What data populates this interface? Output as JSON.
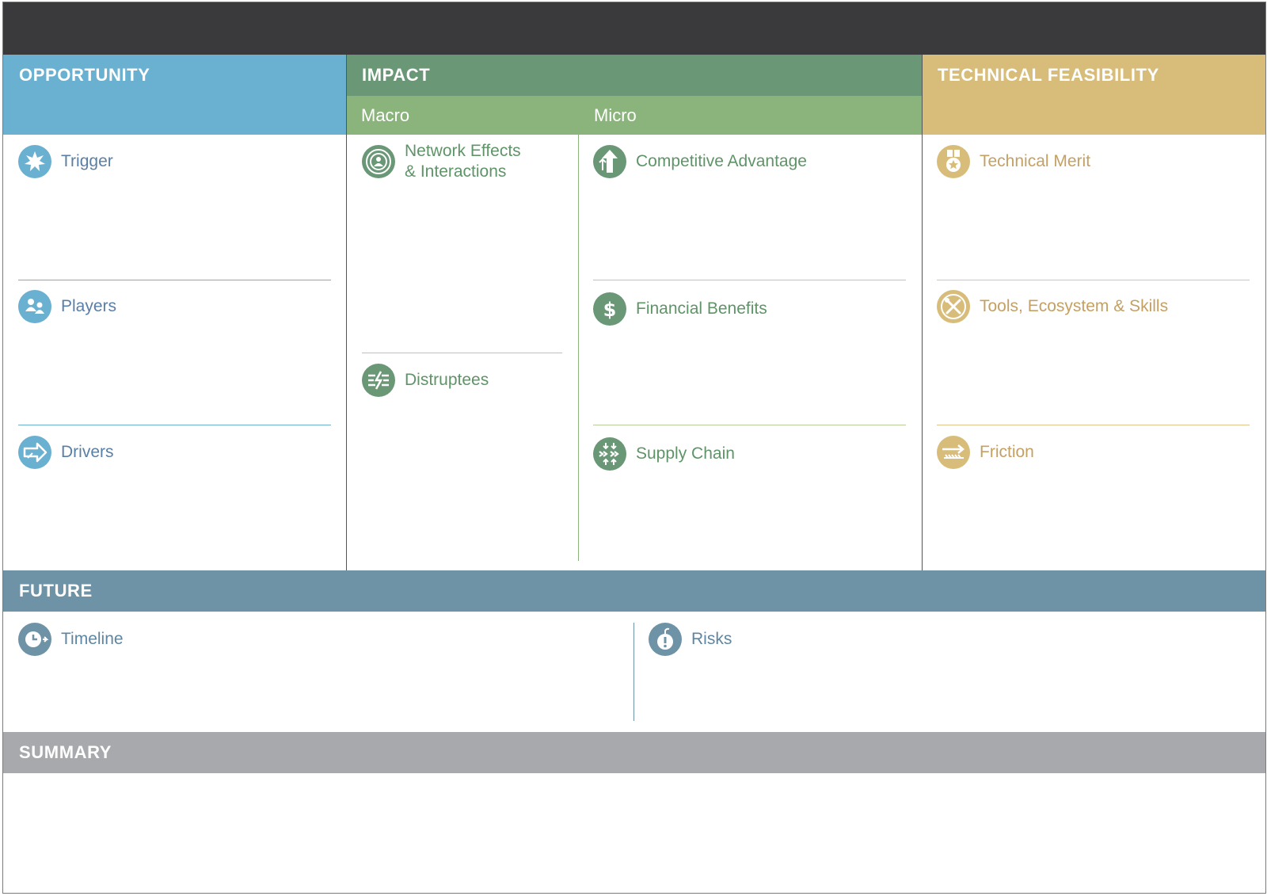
{
  "title_bar": "",
  "colors": {
    "opportunity": "#6ab0d0",
    "impact": "#6a9776",
    "impact_sub": "#8bb47d",
    "technical_feasibility": "#d8bc79",
    "future": "#6f93a6",
    "summary": "#a7a9ac",
    "top_bar": "#3a3a3c"
  },
  "opportunity": {
    "header": "OPPORTUNITY",
    "items": [
      {
        "label": "Trigger",
        "icon": "burst-icon"
      },
      {
        "label": "Players",
        "icon": "people-icon"
      },
      {
        "label": "Drivers",
        "icon": "arrow-icon"
      }
    ]
  },
  "impact": {
    "header": "IMPACT",
    "macro": {
      "header": "Macro",
      "items": [
        {
          "label_line1": "Network Effects",
          "label_line2": "& Interactions",
          "icon": "network-icon"
        },
        {
          "label": "Distruptees",
          "icon": "disruption-icon"
        }
      ]
    },
    "micro": {
      "header": "Micro",
      "items": [
        {
          "label": "Competitive Advantage",
          "icon": "up-arrow-icon"
        },
        {
          "label": "Financial Benefits",
          "icon": "dollar-icon"
        },
        {
          "label": "Supply Chain",
          "icon": "supply-chain-icon"
        }
      ]
    }
  },
  "technical_feasibility": {
    "header": "TECHNICAL FEASIBILITY",
    "items": [
      {
        "label": "Technical Merit",
        "icon": "medal-icon"
      },
      {
        "label": "Tools, Ecosystem & Skills",
        "icon": "tools-icon"
      },
      {
        "label": "Friction",
        "icon": "friction-icon"
      }
    ]
  },
  "future": {
    "header": "FUTURE",
    "items": [
      {
        "label": "Timeline",
        "icon": "clock-icon"
      },
      {
        "label": "Risks",
        "icon": "bomb-icon"
      }
    ]
  },
  "summary": {
    "header": "SUMMARY"
  }
}
